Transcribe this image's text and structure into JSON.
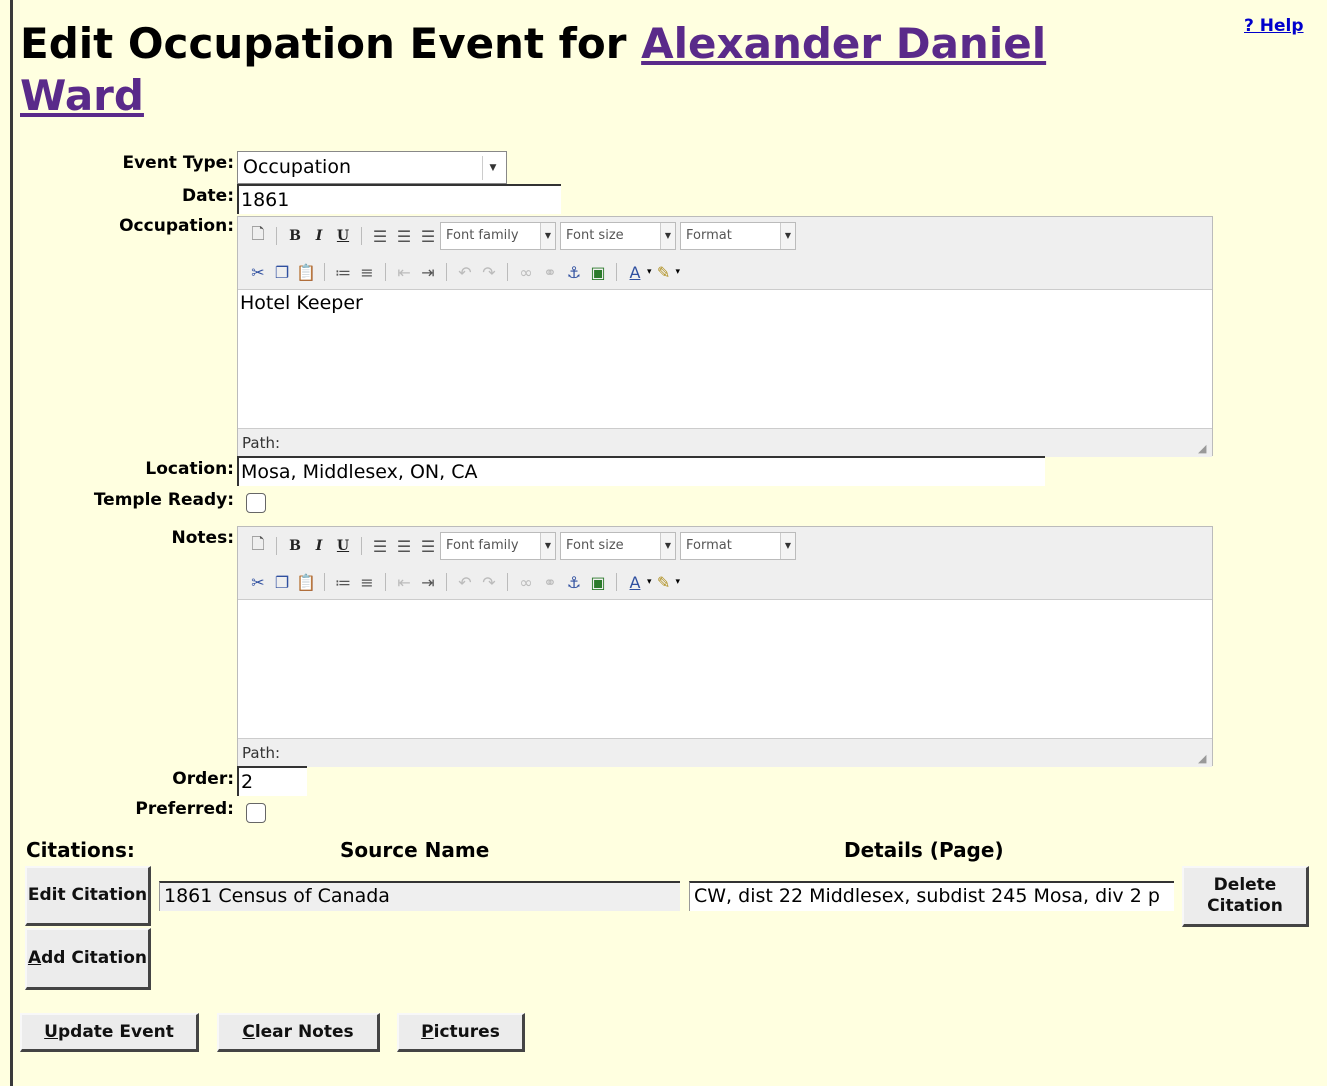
{
  "header": {
    "title_prefix": "Edit Occupation Event for ",
    "person_name": "Alexander Daniel Ward",
    "help_link": "? Help"
  },
  "form": {
    "event_type": {
      "label": "Event Type:",
      "value": "Occupation"
    },
    "date": {
      "label": "Date:",
      "value": "1861"
    },
    "occupation": {
      "label": "Occupation:",
      "value": "Hotel Keeper"
    },
    "location": {
      "label": "Location:",
      "value": "Mosa, Middlesex, ON, CA"
    },
    "temple_ready": {
      "label": "Temple Ready:",
      "checked": false
    },
    "notes": {
      "label": "Notes:",
      "value": ""
    },
    "order": {
      "label": "Order:",
      "value": "2"
    },
    "preferred": {
      "label": "Preferred:",
      "checked": false
    }
  },
  "editor": {
    "font_family": "Font family",
    "font_size": "Font size",
    "format": "Format",
    "path_label": "Path:",
    "toolbar_row1_icons": [
      "new-document-icon",
      "bold-icon",
      "italic-icon",
      "underline-icon",
      "align-left-icon",
      "align-center-icon",
      "align-right-icon"
    ],
    "toolbar_row2_icons": [
      "cut-icon",
      "copy-icon",
      "paste-icon",
      "bullet-list-icon",
      "numbered-list-icon",
      "outdent-icon",
      "indent-icon",
      "undo-icon",
      "redo-icon",
      "link-icon",
      "unlink-icon",
      "anchor-icon",
      "image-icon",
      "text-color-icon",
      "highlight-color-icon"
    ]
  },
  "citations": {
    "label": "Citations:",
    "source_name_header": "Source Name",
    "details_header": "Details (Page)",
    "rows": [
      {
        "edit_label": "Edit Citation",
        "source_name": "1861 Census of Canada",
        "details": "CW, dist 22 Middlesex, subdist 245 Mosa, div 2 p",
        "delete_label": "Delete Citation"
      }
    ],
    "add_label_first": "A",
    "add_label_rest": "dd Citation"
  },
  "actions": {
    "update_first": "U",
    "update_rest": "pdate Event",
    "clear_first": "C",
    "clear_rest": "lear Notes",
    "pictures_first": "P",
    "pictures_rest": "ictures"
  }
}
